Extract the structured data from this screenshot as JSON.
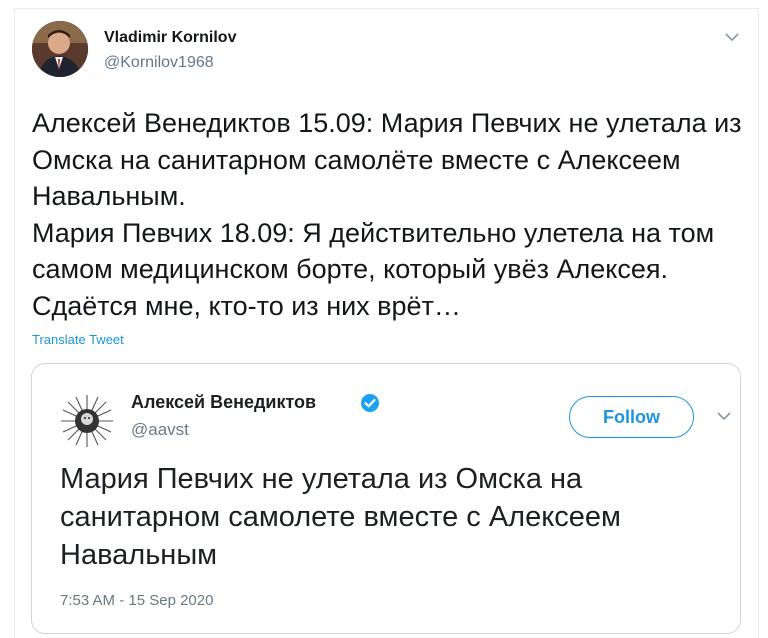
{
  "tweet": {
    "author_name": "Vladimir Kornilov",
    "author_handle": "@Kornilov1968",
    "body_lines": [
      "Алексей Венедиктов 15.09: Мария Певчих не улетала из Омска на санитарном самолёте вместе с Алексеем Навальным.",
      "Мария Певчих 18.09: Я действительно улетела на том самом медицинском борте, который увёз Алексея. Сдаётся мне, кто-то из них врёт…"
    ],
    "translate_label": "Translate Tweet"
  },
  "quoted_tweet": {
    "author_name": "Алексей Венедиктов",
    "author_handle": "@aavst",
    "follow_label": "Follow",
    "text": "Мария Певчих не улетала из Омска на санитарном самолете вместе с Алексеем Навальным",
    "timestamp": "7:53 AM - 15 Sep 2020"
  },
  "icons": {
    "more": "chevron-down-icon",
    "verified": "verified-badge-icon"
  },
  "colors": {
    "link": "#1b95e0",
    "muted": "#657786",
    "border": "#e6ecf0",
    "verified": "#1da1f2"
  }
}
